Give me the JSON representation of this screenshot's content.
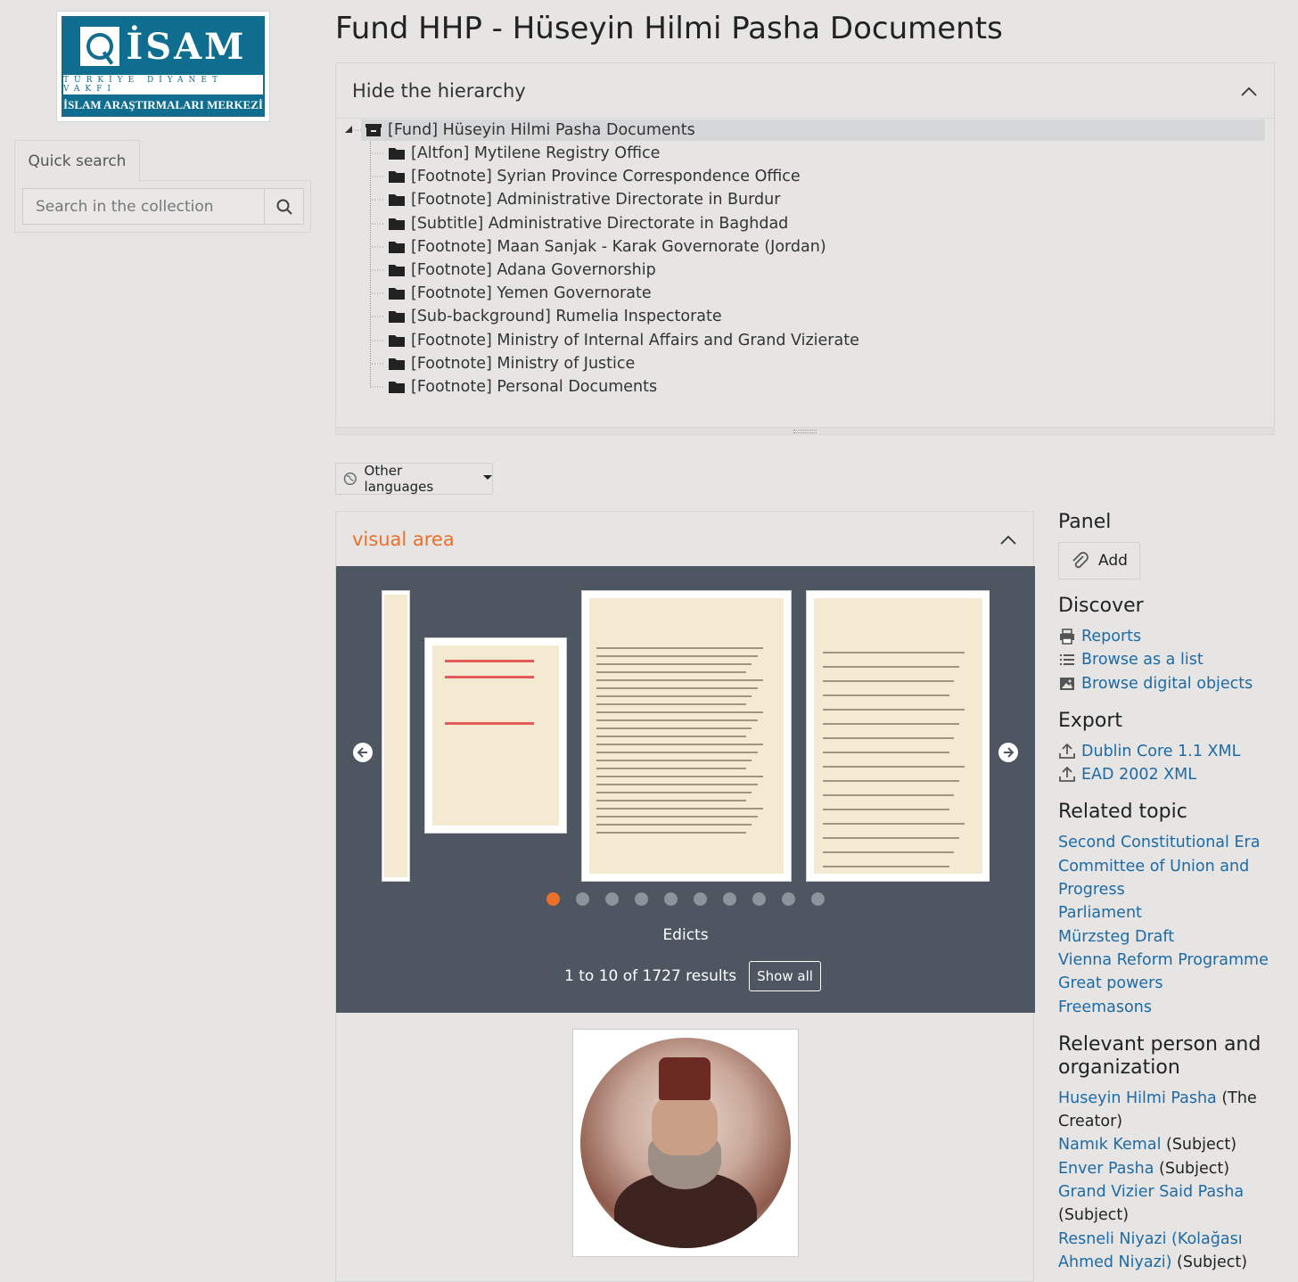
{
  "logo": {
    "word": "İSAM",
    "line1": "TÜRKİYE DİYANET VAKFI",
    "line2": "İSLAM ARAŞTIRMALARI MERKEZİ"
  },
  "quick_search": {
    "tab_label": "Quick search",
    "placeholder": "Search in the collection"
  },
  "page_title": "Fund HHP - Hüseyin Hilmi Pasha Documents",
  "hierarchy": {
    "toggle_label": "Hide the hierarchy",
    "root": "[Fund] Hüseyin Hilmi Pasha Documents",
    "children": [
      "[Altfon] Mytilene Registry Office",
      "[Footnote] Syrian Province Correspondence Office",
      "[Footnote] Administrative Directorate in Burdur",
      "[Subtitle] Administrative Directorate in Baghdad",
      "[Footnote] Maan Sanjak - Karak Governorate (Jordan)",
      "[Footnote] Adana Governorship",
      "[Footnote] Yemen Governorate",
      "[Sub-background] Rumelia Inspectorate",
      "[Footnote] Ministry of Internal Affairs and Grand Vizierate",
      "[Footnote] Ministry of Justice",
      "[Footnote] Personal Documents"
    ]
  },
  "languages": {
    "label": "Other languages"
  },
  "visual_area": {
    "title": "visual area",
    "carousel_title": "Edicts",
    "results_text": "1 to 10 of 1727 results",
    "show_all": "Show all",
    "active_dot": 0,
    "dot_count": 10
  },
  "panel": {
    "panel_title": "Panel",
    "add_label": "Add",
    "discover_title": "Discover",
    "discover": [
      "Reports",
      "Browse as a list",
      "Browse digital objects"
    ],
    "export_title": "Export",
    "export": [
      "Dublin Core 1.1 XML",
      "EAD 2002 XML"
    ],
    "topics_title": "Related topic",
    "topics": [
      "Second Constitutional Era",
      "Committee of Union and",
      "Progress",
      "Parliament",
      "Mürzsteg Draft",
      "Vienna Reform Programme",
      "Great powers",
      "Freemasons"
    ],
    "persons_title_1": "Relevant person and",
    "persons_title_2": "organization",
    "persons": [
      {
        "name": "Huseyin Hilmi Pasha",
        "role": " (The"
      },
      {
        "name": "",
        "role": "Creator)"
      },
      {
        "name": "Namık Kemal",
        "role": " (Subject)"
      },
      {
        "name": "Enver Pasha",
        "role": " (Subject)"
      },
      {
        "name": "Grand Vizier Said Pasha",
        "role": ""
      },
      {
        "name": "",
        "role": "(Subject)"
      },
      {
        "name": "Resneli Niyazi (Kolağası",
        "role": ""
      },
      {
        "name": "Ahmed Niyazi)",
        "role": " (Subject)"
      }
    ]
  },
  "colors": {
    "accent": "#e96f2b",
    "link": "#1d6aa5",
    "carousel_bg": "#4e5761",
    "brand": "#0f6d90"
  }
}
